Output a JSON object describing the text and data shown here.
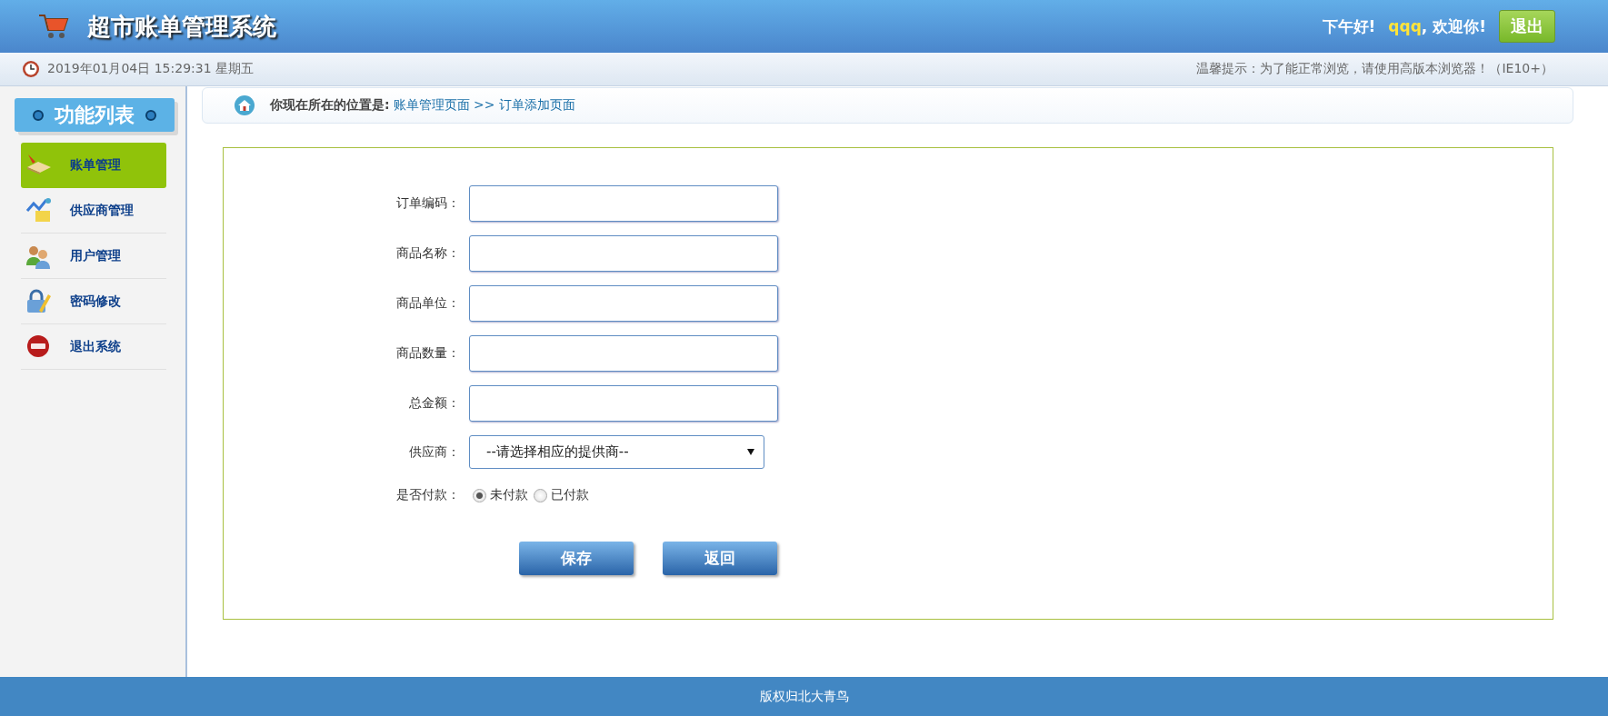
{
  "header": {
    "title": "超市账单管理系统",
    "greeting": "下午好!",
    "user": "qqq",
    "welcome": ", 欢迎你!",
    "logout": "退出"
  },
  "info_bar": {
    "datetime": "2019年01月04日 15:29:31 星期五",
    "notice": "温馨提示：为了能正常浏览，请使用高版本浏览器！（IE10+）"
  },
  "sidebar": {
    "title": "功能列表",
    "items": [
      {
        "label": "账单管理",
        "kind": "bill",
        "selected": true
      },
      {
        "label": "供应商管理",
        "kind": "supplier",
        "selected": false
      },
      {
        "label": "用户管理",
        "kind": "user",
        "selected": false
      },
      {
        "label": "密码修改",
        "kind": "password",
        "selected": false
      },
      {
        "label": "退出系统",
        "kind": "exit",
        "selected": false
      }
    ]
  },
  "breadcrumb": {
    "prefix": "你现在所在的位置是:",
    "location": "账单管理页面 >> 订单添加页面"
  },
  "form": {
    "fields": [
      {
        "kind": "text",
        "label": "订单编码："
      },
      {
        "kind": "text",
        "label": "商品名称："
      },
      {
        "kind": "text",
        "label": "商品单位："
      },
      {
        "kind": "text",
        "label": "商品数量："
      },
      {
        "kind": "text",
        "label": "总金额："
      },
      {
        "kind": "select",
        "label": "供应商：",
        "value": "--请选择相应的提供商--"
      },
      {
        "kind": "radio",
        "label": "是否付款：",
        "options": [
          {
            "label": "未付款",
            "selected": true
          },
          {
            "label": "已付款",
            "selected": false
          }
        ]
      }
    ],
    "buttons": [
      "保存",
      "返回"
    ]
  },
  "footer": {
    "text": "版权归北大青鸟"
  }
}
